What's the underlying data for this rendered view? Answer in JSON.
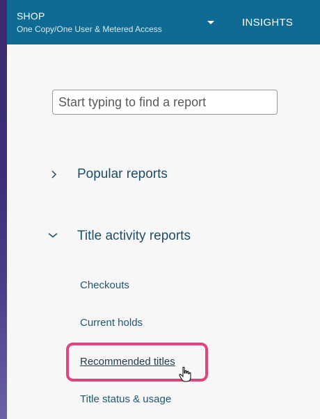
{
  "header": {
    "shop_title": "SHOP",
    "shop_subtitle": "One Copy/One User & Metered Access",
    "insights_label": "INSIGHTS"
  },
  "search": {
    "placeholder": "Start typing to find a report"
  },
  "nav": {
    "popular_label": "Popular reports",
    "title_activity_label": "Title activity reports",
    "items": [
      {
        "label": "Checkouts"
      },
      {
        "label": "Current holds"
      },
      {
        "label": "Recommended titles"
      },
      {
        "label": "Title status & usage"
      }
    ]
  },
  "colors": {
    "header_bg": "#0f6b93",
    "highlight": "#e0437f",
    "link": "#1e5670"
  }
}
